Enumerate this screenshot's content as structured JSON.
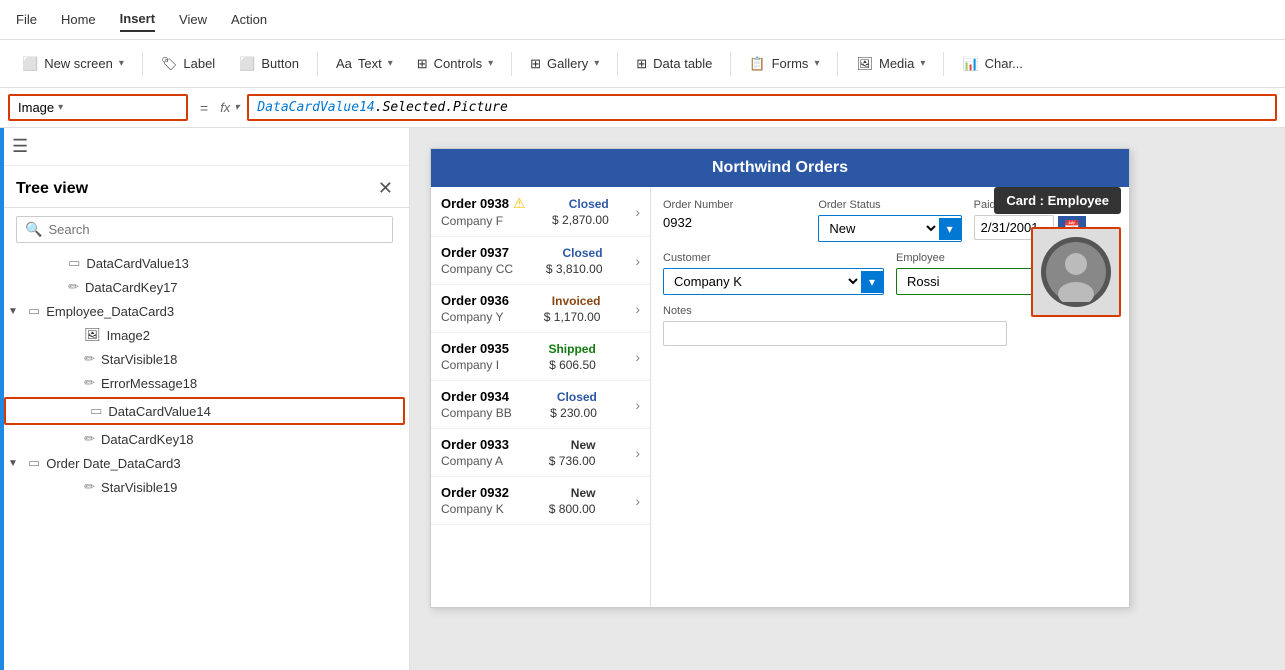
{
  "menu": {
    "items": [
      "File",
      "Home",
      "Insert",
      "View",
      "Action"
    ],
    "active": "Insert"
  },
  "toolbar": {
    "new_screen_label": "New screen",
    "label_label": "Label",
    "button_label": "Button",
    "text_label": "Text",
    "controls_label": "Controls",
    "gallery_label": "Gallery",
    "data_table_label": "Data table",
    "forms_label": "Forms",
    "media_label": "Media",
    "chart_label": "Char..."
  },
  "formula_bar": {
    "name": "Image",
    "fx": "fx",
    "formula": "DataCardValue14.Selected.Picture",
    "formula_part1": "DataCardValue14",
    "formula_part2": ".Selected.Picture"
  },
  "sidebar": {
    "title": "Tree view",
    "search_placeholder": "Search",
    "items": [
      {
        "id": "datacardvalue13",
        "label": "DataCardValue13",
        "indent": 3,
        "icon": "▭",
        "type": "control"
      },
      {
        "id": "datacardkey17",
        "label": "DataCardKey17",
        "indent": 3,
        "icon": "✏",
        "type": "control"
      },
      {
        "id": "employee-datacard3",
        "label": "Employee_DataCard3",
        "indent": 2,
        "icon": "▭",
        "type": "card",
        "expanded": true
      },
      {
        "id": "image2",
        "label": "Image2",
        "indent": 4,
        "icon": "🖼",
        "type": "image"
      },
      {
        "id": "starvisible18",
        "label": "StarVisible18",
        "indent": 4,
        "icon": "✏",
        "type": "control"
      },
      {
        "id": "errormessage18",
        "label": "ErrorMessage18",
        "indent": 4,
        "icon": "✏",
        "type": "control"
      },
      {
        "id": "datacardvalue14",
        "label": "DataCardValue14",
        "indent": 4,
        "icon": "▭",
        "type": "control",
        "highlighted": true
      },
      {
        "id": "datacardkey18",
        "label": "DataCardKey18",
        "indent": 4,
        "icon": "✏",
        "type": "control"
      },
      {
        "id": "order-date-datacard3",
        "label": "Order Date_DataCard3",
        "indent": 2,
        "icon": "▭",
        "type": "card",
        "expanded": true
      },
      {
        "id": "starvisible19",
        "label": "StarVisible19",
        "indent": 4,
        "icon": "✏",
        "type": "control"
      }
    ]
  },
  "app": {
    "title": "Northwind Orders",
    "orders": [
      {
        "num": "Order 0938",
        "company": "Company F",
        "status": "Closed",
        "amount": "$ 2,870.00",
        "warn": true
      },
      {
        "num": "Order 0937",
        "company": "Company CC",
        "status": "Closed",
        "amount": "$ 3,810.00",
        "warn": false
      },
      {
        "num": "Order 0936",
        "company": "Company Y",
        "status": "Invoiced",
        "amount": "$ 1,170.00",
        "warn": false
      },
      {
        "num": "Order 0935",
        "company": "Company I",
        "status": "Shipped",
        "amount": "$ 606.50",
        "warn": false
      },
      {
        "num": "Order 0934",
        "company": "Company BB",
        "status": "Closed",
        "amount": "$ 230.00",
        "warn": false
      },
      {
        "num": "Order 0933",
        "company": "Company A",
        "status": "New",
        "amount": "$ 736.00",
        "warn": false
      },
      {
        "num": "Order 0932",
        "company": "Company K",
        "status": "New",
        "amount": "$ 800.00",
        "warn": false
      }
    ],
    "detail": {
      "order_number_label": "Order Number",
      "order_number_value": "0932",
      "order_status_label": "Order Status",
      "order_status_value": "New",
      "paid_date_label": "Paid Date",
      "paid_date_value": "2/31/2001",
      "customer_label": "Customer",
      "customer_value": "Company K",
      "employee_label": "Employee",
      "employee_value": "Rossi",
      "notes_label": "Notes",
      "notes_value": ""
    },
    "tooltip": "Card : Employee"
  }
}
